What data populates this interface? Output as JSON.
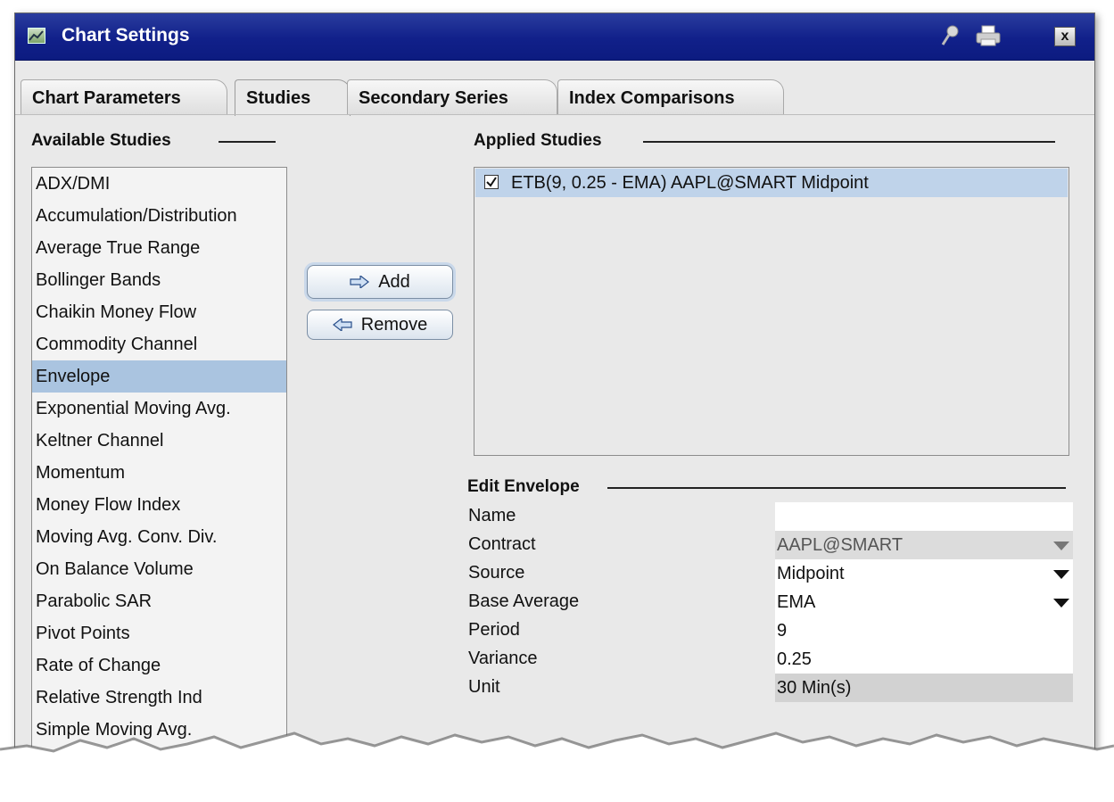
{
  "window": {
    "title": "Chart Settings",
    "icons": [
      "chart-icon",
      "pin-icon",
      "print-icon",
      "close-icon"
    ],
    "close_label": "x"
  },
  "tabs": [
    {
      "label": "Chart Parameters",
      "active": false
    },
    {
      "label": "Studies",
      "active": true
    },
    {
      "label": "Secondary Series",
      "active": false
    },
    {
      "label": "Index Comparisons",
      "active": false
    }
  ],
  "available": {
    "heading": "Available Studies",
    "items": [
      "ADX/DMI",
      "Accumulation/Distribution",
      "Average True Range",
      "Bollinger Bands",
      "Chaikin Money Flow",
      "Commodity Channel",
      "Envelope",
      "Exponential Moving Avg.",
      "Keltner Channel",
      "Momentum",
      "Money Flow Index",
      "Moving Avg. Conv. Div.",
      "On Balance Volume",
      "Parabolic SAR",
      "Pivot Points",
      "Rate of Change",
      "Relative Strength Ind",
      "Simple Moving Avg."
    ],
    "selected": "Envelope"
  },
  "buttons": {
    "add_label": "Add",
    "remove_label": "Remove"
  },
  "applied": {
    "heading": "Applied Studies",
    "items": [
      {
        "label": "ETB(9, 0.25 - EMA) AAPL@SMART Midpoint",
        "checked": true
      }
    ]
  },
  "edit": {
    "heading": "Edit Envelope",
    "fields": [
      {
        "label": "Name",
        "value": ""
      },
      {
        "label": "Contract",
        "value": "AAPL@SMART"
      },
      {
        "label": "Source",
        "value": "Midpoint"
      },
      {
        "label": "Base Average",
        "value": "EMA"
      },
      {
        "label": "Period",
        "value": "9"
      },
      {
        "label": "Variance",
        "value": "0.25"
      },
      {
        "label": "Unit",
        "value": "30 Min(s)"
      }
    ]
  },
  "colors": {
    "titlebar": "#11208a",
    "selection": "#aac4e0",
    "applied_selection": "#bfd3ea"
  }
}
